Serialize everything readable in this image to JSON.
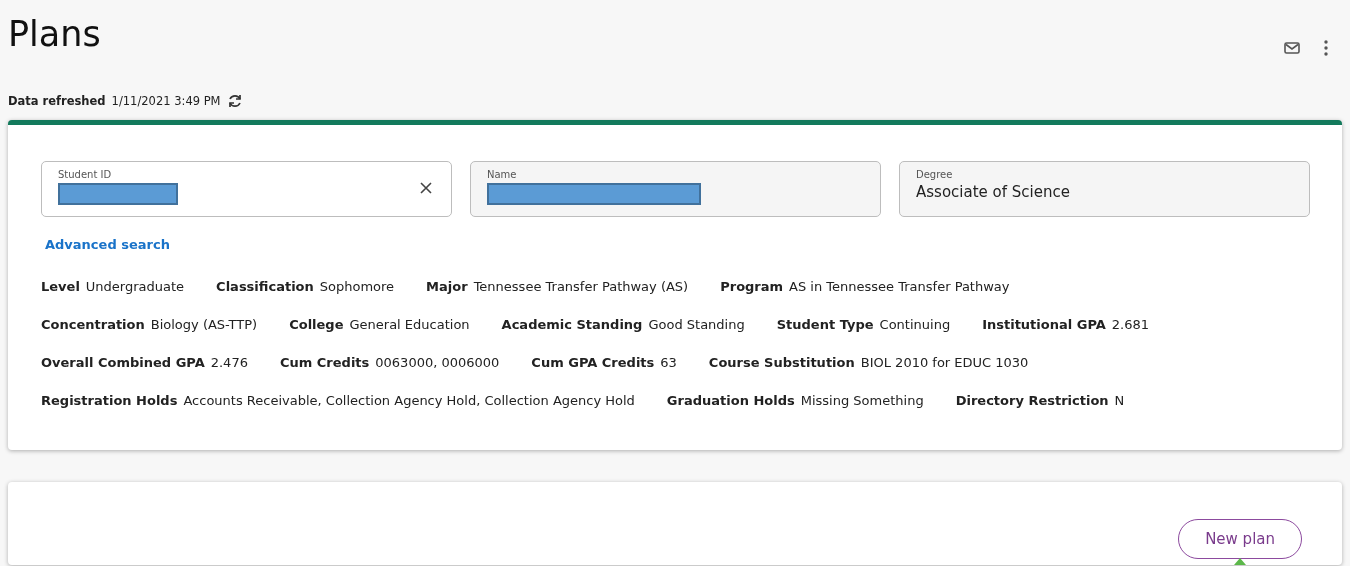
{
  "page": {
    "title": "Plans",
    "refresh_label": "Data refreshed",
    "refresh_time": "1/11/2021 3:49 PM"
  },
  "fields": [
    {
      "label": "Student ID",
      "redacted": true,
      "clearable": true
    },
    {
      "label": "Name",
      "redacted": true,
      "clearable": false
    },
    {
      "label": "Degree",
      "value": "Associate of Science",
      "redacted": false,
      "clearable": false
    }
  ],
  "advanced_search": "Advanced search",
  "details": [
    [
      {
        "label": "Level",
        "value": "Undergraduate"
      },
      {
        "label": "Classification",
        "value": "Sophomore"
      },
      {
        "label": "Major",
        "value": "Tennessee Transfer Pathway (AS)"
      },
      {
        "label": "Program",
        "value": "AS in Tennessee Transfer Pathway"
      }
    ],
    [
      {
        "label": "Concentration",
        "value": "Biology (AS-TTP)"
      },
      {
        "label": "College",
        "value": "General Education"
      },
      {
        "label": "Academic Standing",
        "value": "Good Standing"
      },
      {
        "label": "Student Type",
        "value": "Continuing"
      },
      {
        "label": "Institutional GPA",
        "value": "2.681"
      }
    ],
    [
      {
        "label": "Overall Combined GPA",
        "value": "2.476"
      },
      {
        "label": "Cum Credits",
        "value": "0063000, 0006000"
      },
      {
        "label": "Cum GPA Credits",
        "value": "63"
      },
      {
        "label": "Course Substitution",
        "value": "BIOL 2010 for EDUC 1030"
      }
    ],
    [
      {
        "label": "Registration Holds",
        "value": "Accounts Receivable, Collection Agency Hold, Collection Agency Hold"
      },
      {
        "label": "Graduation Holds",
        "value": "Missing Something"
      },
      {
        "label": "Directory Restriction",
        "value": "N"
      }
    ]
  ],
  "plans_panel": {
    "new_plan_button": "New plan"
  }
}
